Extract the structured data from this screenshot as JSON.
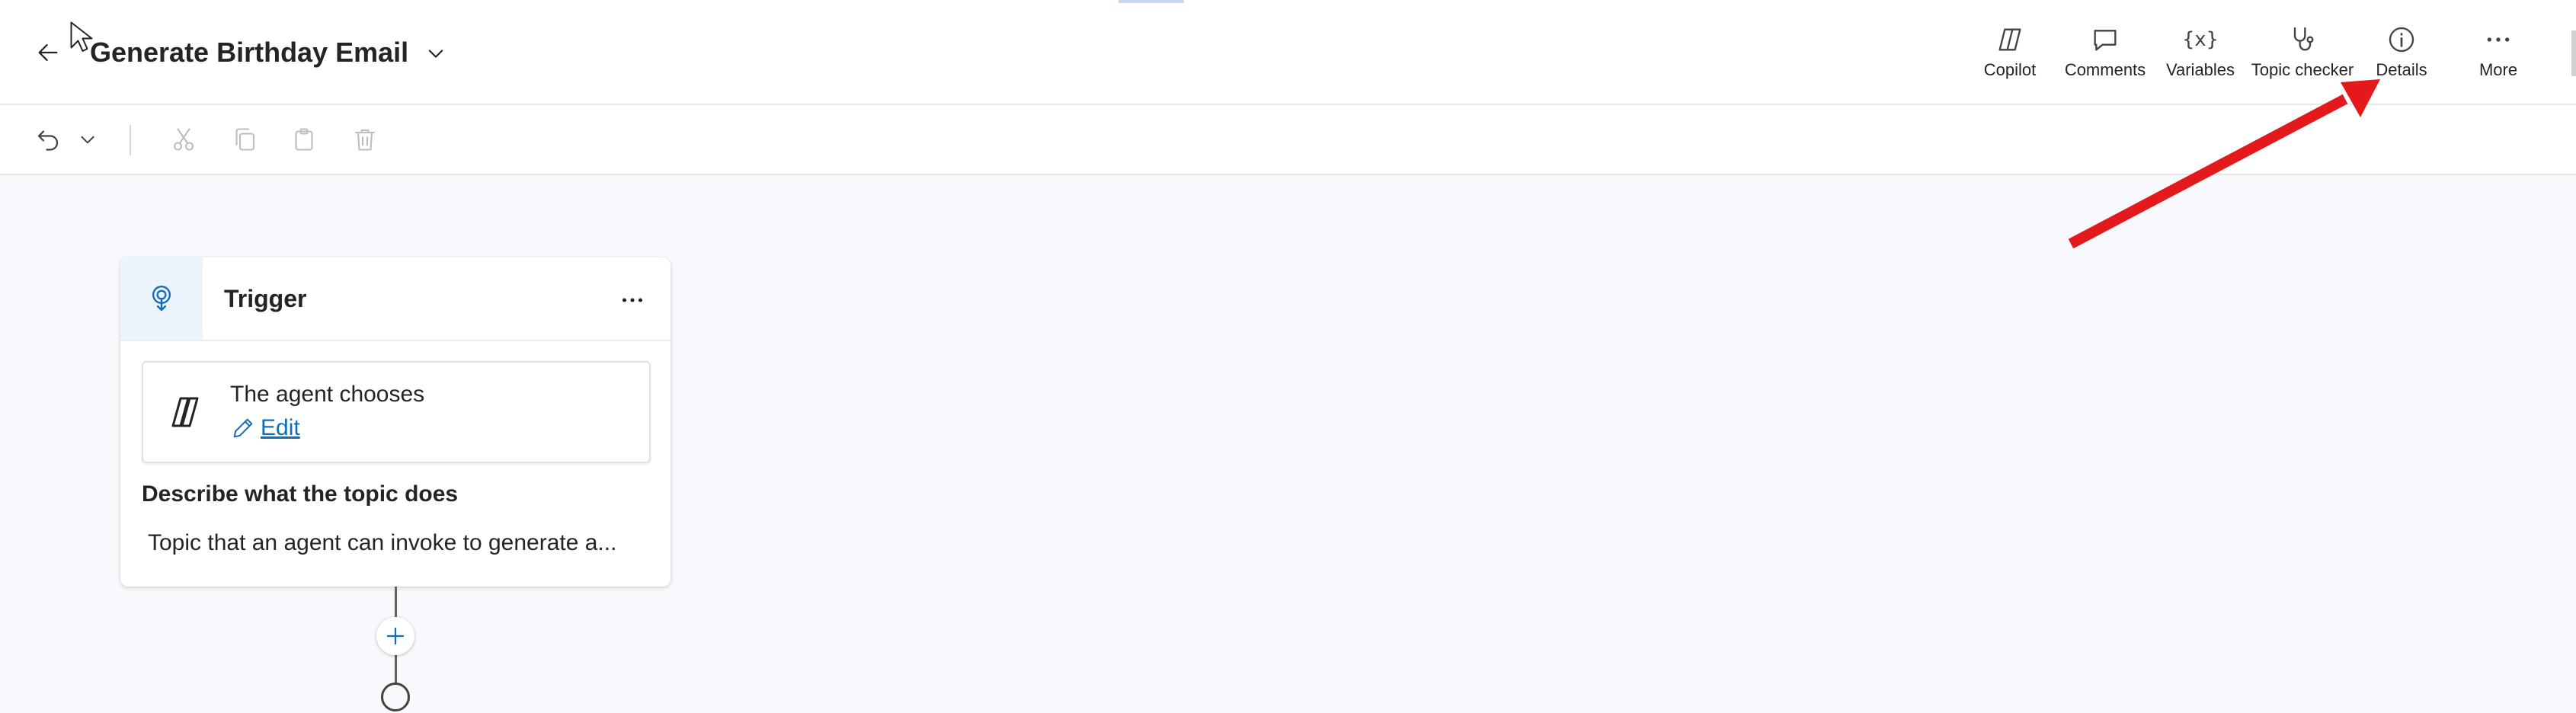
{
  "header": {
    "title": "Generate Birthday Email",
    "tools": [
      {
        "label": "Copilot",
        "icon": "copilot-icon"
      },
      {
        "label": "Comments",
        "icon": "comment-icon"
      },
      {
        "label": "Variables",
        "icon": "variables-icon"
      },
      {
        "label": "Topic checker",
        "icon": "stethoscope-icon"
      },
      {
        "label": "Details",
        "icon": "info-icon"
      },
      {
        "label": "More",
        "icon": "more-icon"
      }
    ],
    "variables_glyph": "{x}"
  },
  "commands": {
    "icons": [
      "undo-icon",
      "chevron-down-icon",
      "cut-icon",
      "copy-icon",
      "paste-icon",
      "delete-icon"
    ]
  },
  "trigger_card": {
    "title": "Trigger",
    "agent_choice": {
      "title": "The agent chooses",
      "edit_label": "Edit"
    },
    "description_label": "Describe what the topic does",
    "description_text": "Topic that an agent can invoke to generate a..."
  },
  "annotation": {
    "arrow_color": "#e3191c",
    "points_to": "Details"
  },
  "colors": {
    "accent": "#0f6cbd",
    "trigger_bg": "#ebf3fc",
    "canvas": "#f8f9fc"
  }
}
